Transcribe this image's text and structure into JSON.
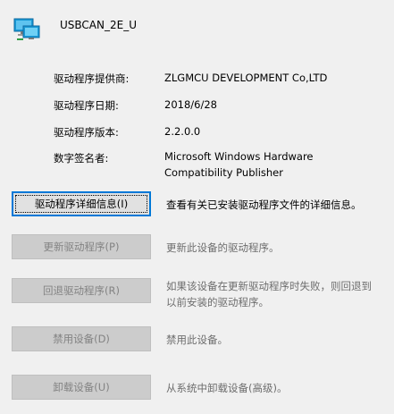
{
  "device": {
    "name": "USBCAN_2E_U",
    "icon": "network-adapter-icon"
  },
  "info": {
    "provider_label": "驱动程序提供商:",
    "provider_value": "ZLGMCU DEVELOPMENT Co,LTD",
    "date_label": "驱动程序日期:",
    "date_value": "2018/6/28",
    "version_label": "驱动程序版本:",
    "version_value": "2.2.0.0",
    "signer_label": "数字签名者:",
    "signer_value_line1": "Microsoft Windows Hardware",
    "signer_value_line2": "Compatibility Publisher"
  },
  "actions": {
    "details": {
      "label": "驱动程序详细信息(I)",
      "description": "查看有关已安装驱动程序文件的详细信息。"
    },
    "update": {
      "label": "更新驱动程序(P)",
      "description": "更新此设备的驱动程序。"
    },
    "rollback": {
      "label": "回退驱动程序(R)",
      "description_line1": "如果该设备在更新驱动程序时失败，则回退到",
      "description_line2": "以前安装的驱动程序。"
    },
    "disable": {
      "label": "禁用设备(D)",
      "description": "禁用此设备。"
    },
    "uninstall": {
      "label": "卸载设备(U)",
      "description": "从系统中卸载设备(高级)。"
    }
  },
  "colors": {
    "background": "#f0f0f0",
    "focus_border": "#0078d7",
    "disabled_button": "#cccccc",
    "disabled_text": "#838383"
  }
}
